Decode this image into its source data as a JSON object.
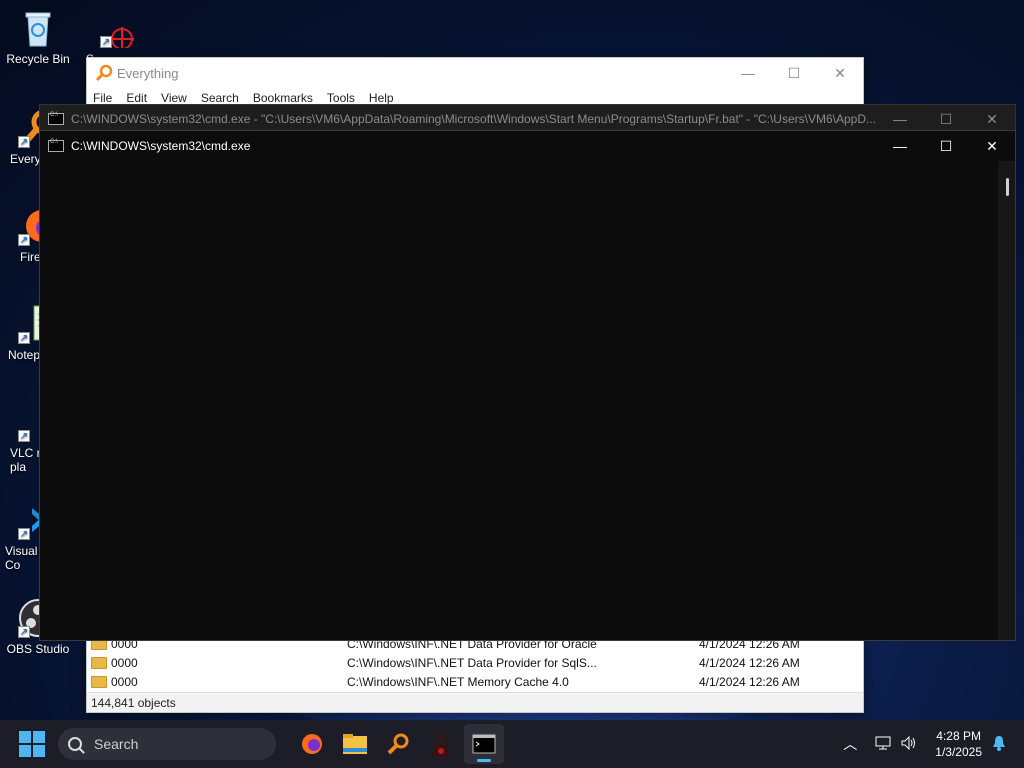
{
  "desktop": {
    "icons": [
      {
        "label": "Recycle Bin"
      },
      {
        "label": "S"
      },
      {
        "label": "Every"
      },
      {
        "label": "Fire"
      },
      {
        "label": "Notep"
      },
      {
        "label": "VLC r\npla"
      },
      {
        "label": "Visual\nCo"
      },
      {
        "label": "OBS Studio"
      }
    ]
  },
  "everything": {
    "title": "Everything",
    "menu": [
      "File",
      "Edit",
      "View",
      "Search",
      "Bookmarks",
      "Tools",
      "Help"
    ],
    "controls": {
      "minimize": "—",
      "maximize": "☐",
      "close": "✕"
    },
    "rows": [
      {
        "name": "0000",
        "path": "C:\\Windows\\INF\\.NET Data Provider for Oracle",
        "date": "4/1/2024 12:26 AM"
      },
      {
        "name": "0000",
        "path": "C:\\Windows\\INF\\.NET Data Provider for SqlS...",
        "date": "4/1/2024 12:26 AM"
      },
      {
        "name": "0000",
        "path": "C:\\Windows\\INF\\.NET Memory Cache 4.0",
        "date": "4/1/2024 12:26 AM"
      }
    ],
    "status": "144,841 objects"
  },
  "cmd_back": {
    "title": "C:\\WINDOWS\\system32\\cmd.exe - \"C:\\Users\\VM6\\AppData\\Roaming\\Microsoft\\Windows\\Start Menu\\Programs\\Startup\\Fr.bat\" - \"C:\\Users\\VM6\\AppD..."
  },
  "cmd_front": {
    "title": "C:\\WINDOWS\\system32\\cmd.exe",
    "controls": {
      "minimize": "—",
      "maximize": "☐",
      "close": "✕"
    }
  },
  "taskbar": {
    "search_placeholder": "Search",
    "time": "4:28 PM",
    "date": "1/3/2025",
    "apps": [
      "firefox-icon",
      "file-explorer-icon",
      "everything-icon",
      "game-icon",
      "terminal-icon"
    ]
  },
  "colors": {
    "accent": "#4fb6f5",
    "taskbar": "#1c1d26",
    "cmd_bg": "#0c0c0c"
  }
}
